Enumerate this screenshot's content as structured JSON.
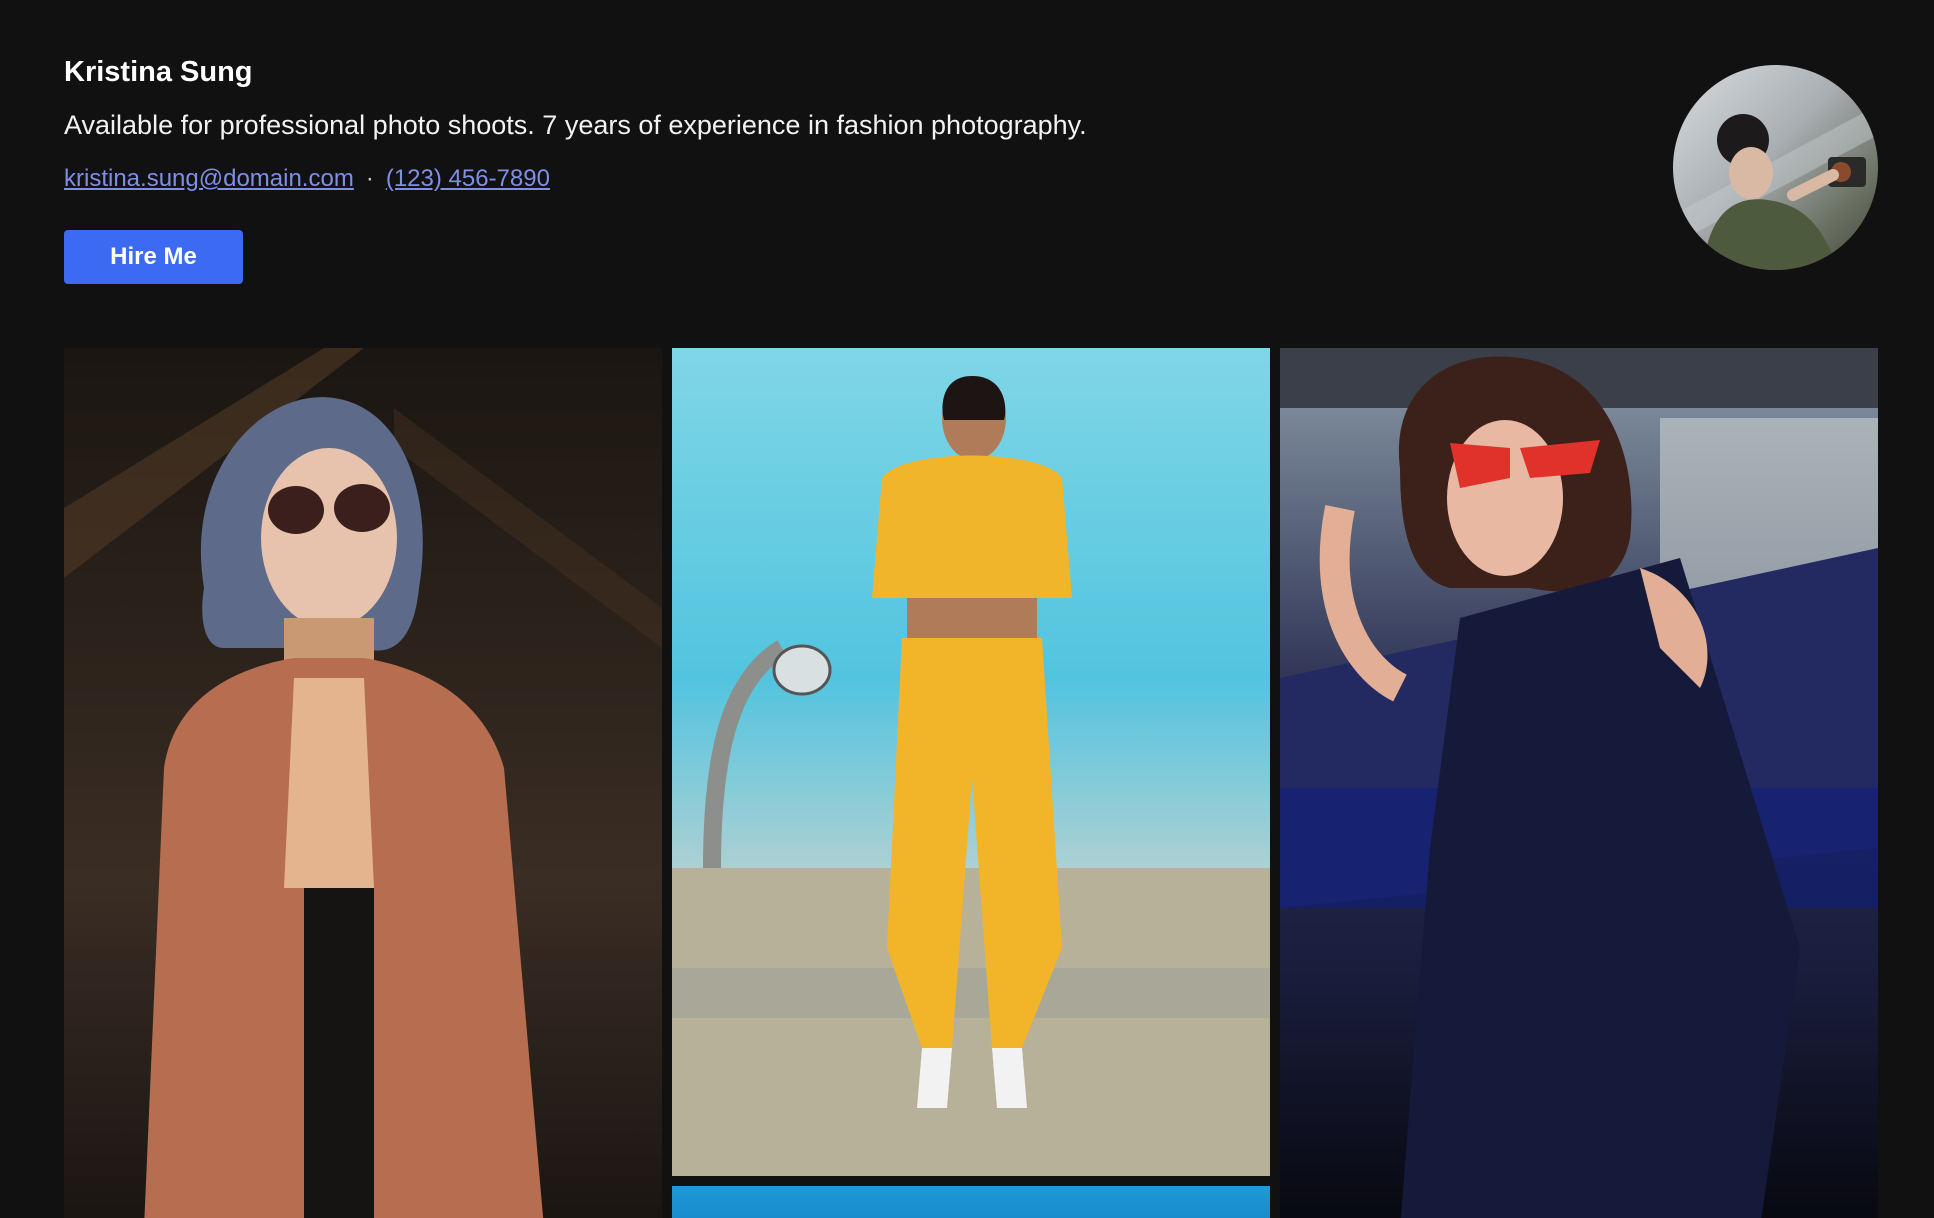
{
  "profile": {
    "name": "Kristina Sung",
    "bio": "Available for professional photo shoots. 7 years of experience in fashion photography.",
    "email": "kristina.sung@domain.com",
    "separator": "·",
    "phone": "(123) 456-7890",
    "hire_label": "Hire Me"
  },
  "colors": {
    "background": "#111111",
    "accent": "#3d6af2",
    "link": "#7f8fe6"
  },
  "gallery": {
    "photos": [
      {
        "name": "photo-woman-coat-sunglasses"
      },
      {
        "name": "photo-woman-yellow-tracksuit"
      },
      {
        "name": "photo-woman-red-sunglasses"
      },
      {
        "name": "photo-blue-sky"
      }
    ]
  }
}
